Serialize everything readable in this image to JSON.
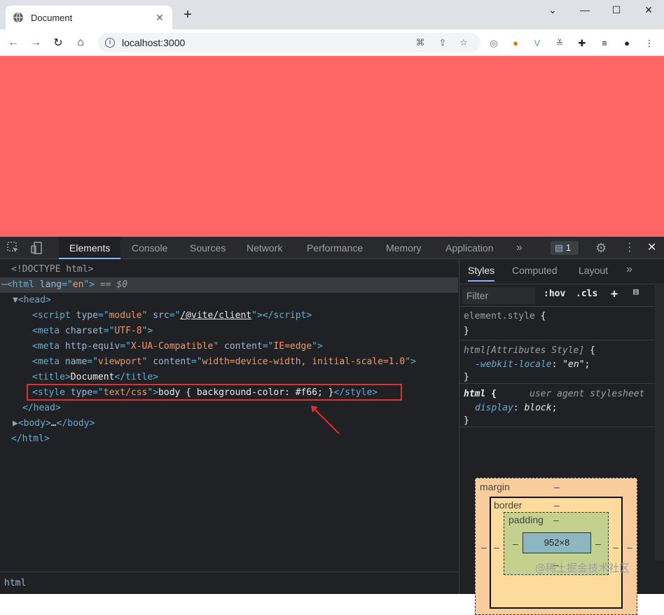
{
  "browser": {
    "tab_title": "Document",
    "url": "localhost:3000"
  },
  "viewport": {
    "background": "#ff6666"
  },
  "devtools": {
    "tabs": [
      "Elements",
      "Console",
      "Sources",
      "Network",
      "Performance",
      "Memory",
      "Application"
    ],
    "more": "»",
    "issues_count": "1",
    "dom": {
      "doctype": "<!DOCTYPE html>",
      "html_lang": "en",
      "selected_ref": "== $0",
      "script_type": "module",
      "script_src": "/@vite/client",
      "meta_charset": "UTF-8",
      "meta_http_equiv": "X-UA-Compatible",
      "meta_content_ie": "IE=edge",
      "meta_name": "viewport",
      "meta_content_vp": "width=device-width, initial-scale=1.0",
      "title_text": "Document",
      "style_type": "text/css",
      "style_text": "body { background-color: #f66; }"
    },
    "breadcrumb": "html",
    "styles": {
      "tabs": [
        "Styles",
        "Computed",
        "Layout"
      ],
      "filter_placeholder": "Filter",
      "hov": ":hov",
      "cls": ".cls",
      "rules": {
        "element_style": "element.style",
        "attr_selector": "html[Attributes Style]",
        "attr_prop": "-webkit-locale",
        "attr_val": "\"en\"",
        "ua_selector": "html",
        "ua_source": "user agent stylesheet",
        "ua_prop": "display",
        "ua_val": "block"
      },
      "box_model": {
        "margin": "margin",
        "border": "border",
        "padding": "padding",
        "dash": "–",
        "content": "952×8"
      }
    }
  },
  "watermark": "@稀土掘金技术社区"
}
